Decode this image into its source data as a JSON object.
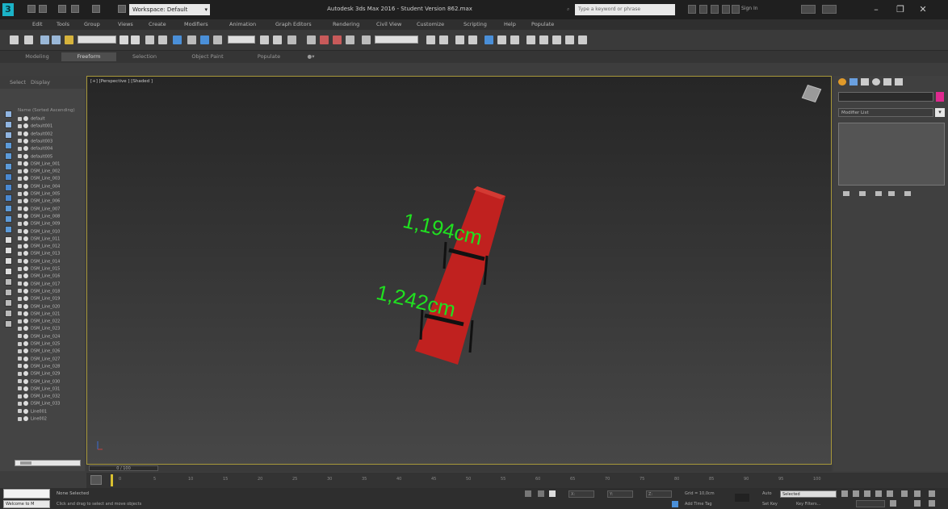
{
  "titlebar": {
    "app_icon_glyph": "3",
    "workspace": "Workspace: Default",
    "title": "Autodesk 3ds Max 2016 - Student Version  862.max",
    "search_placeholder": "Type a keyword or phrase",
    "sign_in": "Sign In",
    "minimize": "–",
    "restore": "❐",
    "close": "✕"
  },
  "menu": [
    "Edit",
    "Tools",
    "Group",
    "Views",
    "Create",
    "Modifiers",
    "Animation",
    "Graph Editors",
    "Rendering",
    "Civil View",
    "Customize",
    "Scripting",
    "Help",
    "Populate"
  ],
  "ribbon_tabs": [
    "Modeling",
    "Freeform",
    "Selection",
    "Object Paint",
    "Populate"
  ],
  "ribbon_active_index": 1,
  "scene_explorer": {
    "tabs": [
      "Select",
      "Display"
    ],
    "header": "Name (Sorted Ascending)",
    "items": [
      "default",
      "default001",
      "default002",
      "default003",
      "default004",
      "default005",
      "DSM_Line_001",
      "DSM_Line_002",
      "DSM_Line_003",
      "DSM_Line_004",
      "DSM_Line_005",
      "DSM_Line_006",
      "DSM_Line_007",
      "DSM_Line_008",
      "DSM_Line_009",
      "DSM_Line_010",
      "DSM_Line_011",
      "DSM_Line_012",
      "DSM_Line_013",
      "DSM_Line_014",
      "DSM_Line_015",
      "DSM_Line_016",
      "DSM_Line_017",
      "DSM_Line_018",
      "DSM_Line_019",
      "DSM_Line_020",
      "DSM_Line_021",
      "DSM_Line_022",
      "DSM_Line_023",
      "DSM_Line_024",
      "DSM_Line_025",
      "DSM_Line_026",
      "DSM_Line_027",
      "DSM_Line_028",
      "DSM_Line_029",
      "DSM_Line_030",
      "DSM_Line_031",
      "DSM_Line_032",
      "DSM_Line_033",
      "Line001",
      "Line002"
    ]
  },
  "viewport": {
    "label": "[+] [Perspective ] [Shaded ]",
    "dimension_top": "1,194cm",
    "dimension_bottom": "1,242cm",
    "model_color": "#c0211f",
    "dimension_color": "#20e020"
  },
  "command_panel": {
    "modifier_list": "Modifier List",
    "name_color": "#e0298f"
  },
  "timeline": {
    "slider": "0 / 100",
    "ticks": [
      "0",
      "5",
      "10",
      "15",
      "20",
      "25",
      "30",
      "35",
      "40",
      "45",
      "50",
      "55",
      "60",
      "65",
      "70",
      "75",
      "80",
      "85",
      "90",
      "95",
      "100"
    ]
  },
  "statusbar": {
    "maxscript": "Welcome to M",
    "selection": "None Selected",
    "prompt": "Click and drag to select and move objects",
    "x_label": "X:",
    "y_label": "Y:",
    "z_label": "Z:",
    "grid": "Grid = 10,0cm",
    "auto": "Auto",
    "set_key": "Set Key",
    "key_mode": "Selected",
    "add_time_tag": "Add Time Tag",
    "filters": "Key Filters..."
  }
}
